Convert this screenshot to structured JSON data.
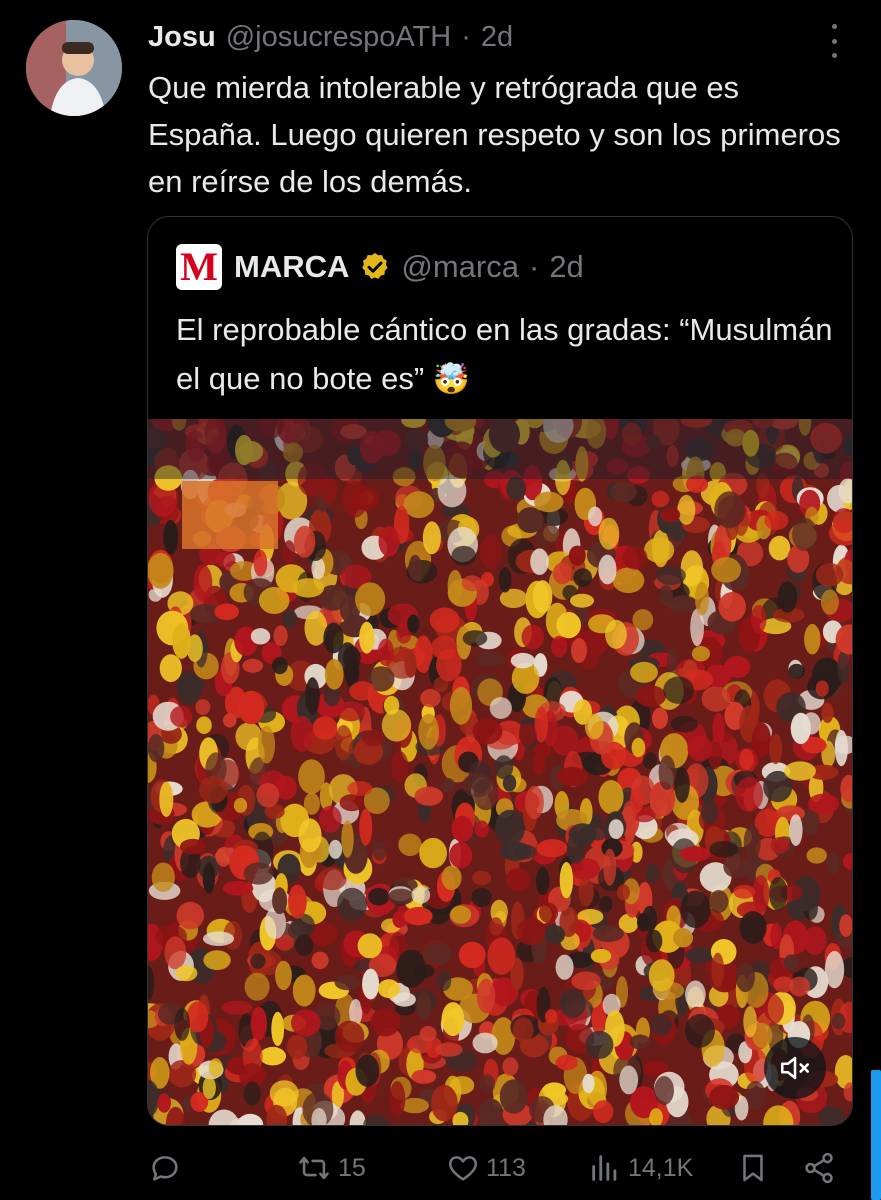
{
  "tweet": {
    "author_name": "Josu",
    "author_handle": "@josucrespoATH",
    "separator": "·",
    "time": "2d",
    "text": "Que mierda intolerable y retrógrada que es España. Luego quieren respeto y son los primeros en reírse de los demás."
  },
  "quoted": {
    "logo_letter": "M",
    "author_name": "MARCA",
    "author_handle": "@marca",
    "separator": "·",
    "time": "2d",
    "text": "El reprobable cántico en las gradas: “Musulmán el que no bote es”",
    "emoji": "🤯"
  },
  "actions": {
    "retweets": "15",
    "likes": "113",
    "views": "14,1K"
  },
  "icons": {
    "reply": "reply-icon",
    "retweet": "retweet-icon",
    "like": "heart-icon",
    "views": "views-icon",
    "bookmark": "bookmark-icon",
    "share": "share-icon",
    "mute": "mute-icon",
    "more": "more-options-icon",
    "verified": "verified-badge-icon"
  },
  "colors": {
    "background": "#000000",
    "text": "#e7e9ea",
    "secondary": "#71767b",
    "border": "#2f3336",
    "verified_gold": "#e2b719",
    "marca_red": "#d6001c"
  }
}
